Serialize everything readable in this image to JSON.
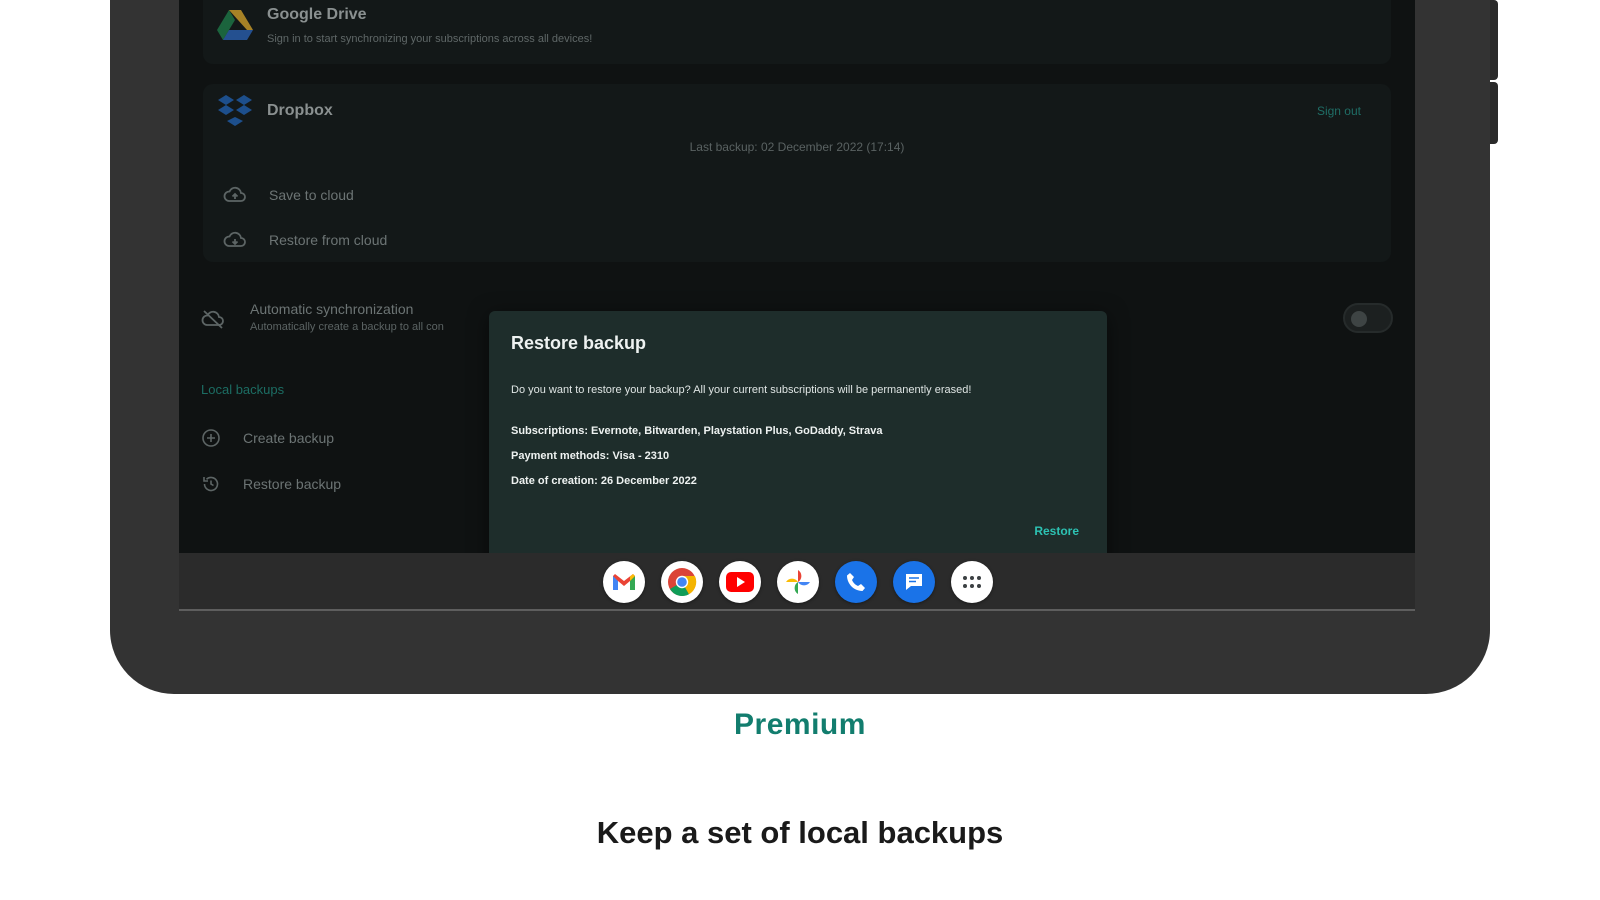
{
  "cloud": {
    "google_drive": {
      "title": "Google Drive",
      "subtitle": "Sign in to start synchronizing your subscriptions across all devices!"
    },
    "dropbox": {
      "title": "Dropbox",
      "sign_out": "Sign out",
      "last_backup": "Last backup: 02 December 2022 (17:14)",
      "save_to_cloud": "Save to cloud",
      "restore_from_cloud": "Restore from cloud"
    }
  },
  "auto_sync": {
    "title": "Automatic synchronization",
    "subtitle": "Automatically create a backup to all con",
    "enabled": false
  },
  "local_backups": {
    "section_title": "Local backups",
    "create_backup": "Create backup",
    "restore_backup": "Restore backup"
  },
  "dialog": {
    "title": "Restore backup",
    "message": "Do you want to restore your backup? All your current subscriptions will be permanently erased!",
    "subscriptions": "Subscriptions: Evernote, Bitwarden, Playstation Plus, GoDaddy, Strava",
    "payment_methods": "Payment methods: Visa - 2310",
    "date_of_creation": "Date of creation: 26 December 2022",
    "restore_label": "Restore"
  },
  "dock": {
    "apps": [
      "gmail-icon",
      "chrome-icon",
      "youtube-icon",
      "photos-icon",
      "phone-icon",
      "messages-icon",
      "app-drawer-icon"
    ]
  },
  "caption": {
    "tier": "Premium",
    "headline": "Keep a set of local backups"
  },
  "colors": {
    "accent": "#127d6e",
    "dialog_bg": "#1e2d2b",
    "dialog_action": "#2dc2b3",
    "screen_bg": "#0f1212",
    "device_frame": "#333333"
  }
}
